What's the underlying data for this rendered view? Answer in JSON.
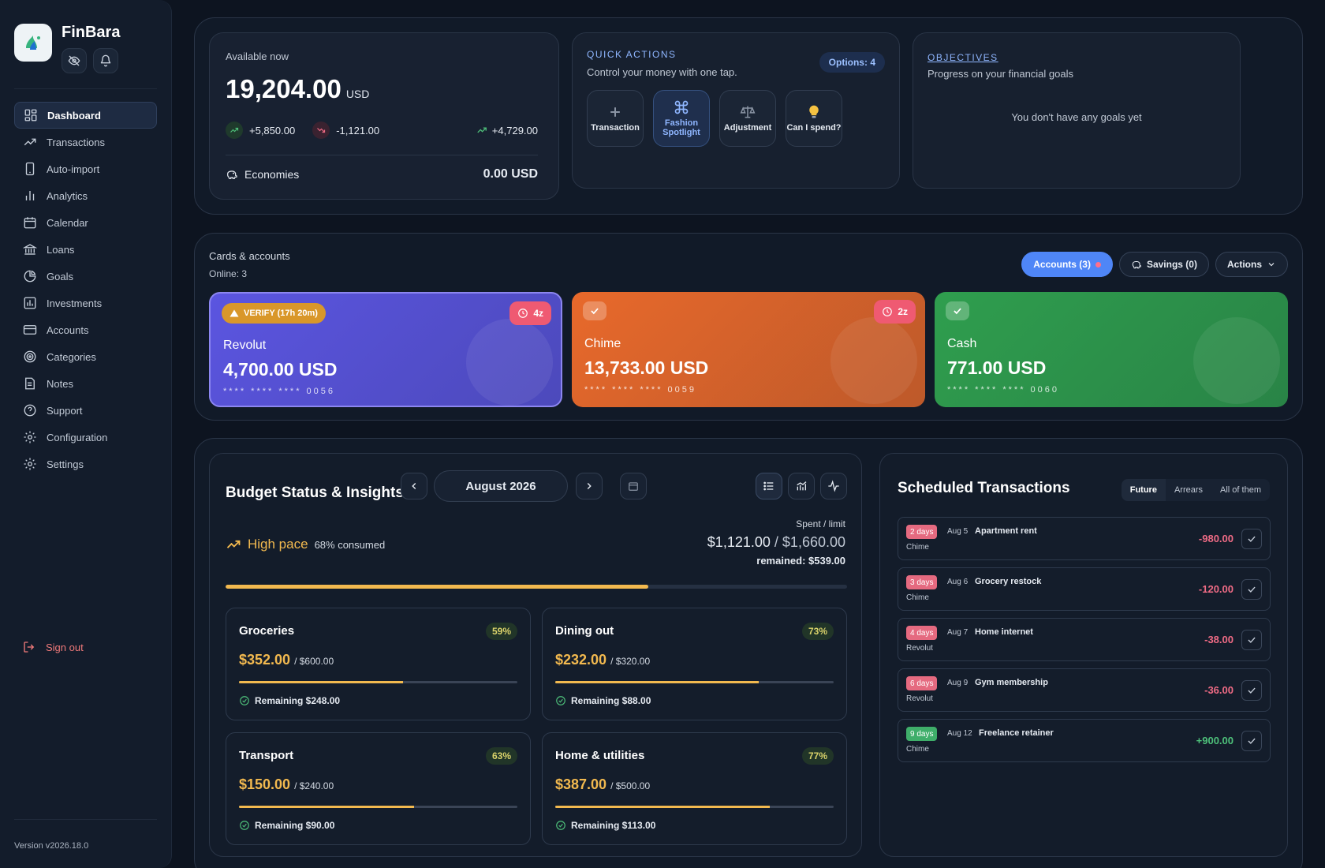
{
  "brand": {
    "name": "FinBara"
  },
  "nav": [
    {
      "label": "Dashboard",
      "icon": "dashboard-icon",
      "active": true
    },
    {
      "label": "Transactions",
      "icon": "trend-icon"
    },
    {
      "label": "Auto-import",
      "icon": "phone-icon"
    },
    {
      "label": "Analytics",
      "icon": "analytics-icon"
    },
    {
      "label": "Calendar",
      "icon": "calendar-icon"
    },
    {
      "label": "Loans",
      "icon": "bank-icon"
    },
    {
      "label": "Goals",
      "icon": "pie-icon"
    },
    {
      "label": "Investments",
      "icon": "investments-icon"
    },
    {
      "label": "Accounts",
      "icon": "card-icon"
    },
    {
      "label": "Categories",
      "icon": "target-icon"
    },
    {
      "label": "Notes",
      "icon": "notes-icon"
    },
    {
      "label": "Support",
      "icon": "help-icon"
    },
    {
      "label": "Configuration",
      "icon": "gear-icon"
    },
    {
      "label": "Settings",
      "icon": "gear-icon"
    }
  ],
  "signout": "Sign out",
  "version": "Version v2026.18.0",
  "balance": {
    "label": "Available now",
    "amount": "19,204.00",
    "currency": "USD",
    "income": "+5,850.00",
    "expense": "-1,121.00",
    "net": "+4,729.00",
    "economies_label": "Economies",
    "economies_value": "0.00 USD"
  },
  "quick_actions": {
    "title": "QUICK ACTIONS",
    "subtitle": "Control your money with one tap.",
    "badge": "Options: 4",
    "items": [
      {
        "label": "Transaction",
        "icon": "plus-icon"
      },
      {
        "label": "Fashion Spotlight",
        "icon": "command-icon"
      },
      {
        "label": "Adjustment",
        "icon": "scale-icon"
      },
      {
        "label": "Can I spend?",
        "icon": "bulb-icon"
      }
    ]
  },
  "objectives": {
    "title": "OBJECTIVES",
    "subtitle": "Progress on your financial goals",
    "empty": "You don't have any goals yet"
  },
  "accounts": {
    "title": "Cards & accounts",
    "online": "Online: 3",
    "tabs": {
      "accounts": "Accounts (3)",
      "savings": "Savings (0)",
      "actions": "Actions"
    },
    "items": [
      {
        "name": "Revolut",
        "amount": "4,700.00 USD",
        "number": "**** **** **** 0056",
        "verify": "VERIFY (17h 20m)",
        "days": "4z",
        "color": "#5b55e0"
      },
      {
        "name": "Chime",
        "amount": "13,733.00 USD",
        "number": "**** **** **** 0059",
        "days": "2z",
        "color": "#e8692b"
      },
      {
        "name": "Cash",
        "amount": "771.00 USD",
        "number": "**** **** **** 0060",
        "color": "#2f9e4e"
      }
    ]
  },
  "budget": {
    "title": "Budget Status & Insights",
    "month": "August 2026",
    "pace_label": "High pace",
    "pace_consumed": "68% consumed",
    "progress": 0.68,
    "spent_label": "Spent / limit",
    "spent": "$1,121.00",
    "sep": "/",
    "limit": "$1,660.00",
    "remained": "remained: $539.00",
    "categories": [
      {
        "name": "Groceries",
        "pct": "59%",
        "spent": "$352.00",
        "limit": "/ $600.00",
        "remaining": "Remaining $248.00",
        "progress": 0.59
      },
      {
        "name": "Dining out",
        "pct": "73%",
        "spent": "$232.00",
        "limit": "/ $320.00",
        "remaining": "Remaining $88.00",
        "progress": 0.73
      },
      {
        "name": "Transport",
        "pct": "63%",
        "spent": "$150.00",
        "limit": "/ $240.00",
        "remaining": "Remaining $90.00",
        "progress": 0.63
      },
      {
        "name": "Home & utilities",
        "pct": "77%",
        "spent": "$387.00",
        "limit": "/ $500.00",
        "remaining": "Remaining $113.00",
        "progress": 0.77
      }
    ]
  },
  "scheduled": {
    "title": "Scheduled Transactions",
    "tabs": [
      "Future",
      "Arrears",
      "All of them"
    ],
    "items": [
      {
        "days": "2 days",
        "date": "Aug 5",
        "desc": "Apartment rent",
        "account": "Chime",
        "amount": "-980.00",
        "type": "out"
      },
      {
        "days": "3 days",
        "date": "Aug 6",
        "desc": "Grocery restock",
        "account": "Chime",
        "amount": "-120.00",
        "type": "out"
      },
      {
        "days": "4 days",
        "date": "Aug 7",
        "desc": "Home internet",
        "account": "Revolut",
        "amount": "-38.00",
        "type": "out"
      },
      {
        "days": "6 days",
        "date": "Aug 9",
        "desc": "Gym membership",
        "account": "Revolut",
        "amount": "-36.00",
        "type": "out"
      },
      {
        "days": "9 days",
        "date": "Aug 12",
        "desc": "Freelance retainer",
        "account": "Chime",
        "amount": "+900.00",
        "type": "in"
      }
    ]
  },
  "colors": {
    "accent": "#4f86f7",
    "warning": "#f2b94f",
    "negative": "#ef6b85",
    "positive": "#4ec07a"
  }
}
